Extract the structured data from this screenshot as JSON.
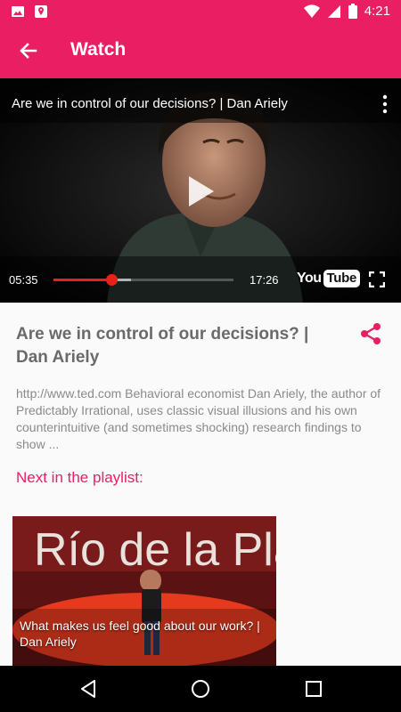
{
  "status_bar": {
    "time": "4:21",
    "icons": [
      "image-icon",
      "location-icon",
      "wifi-icon",
      "signal-icon",
      "battery-icon"
    ]
  },
  "app_bar": {
    "title": "Watch",
    "back_icon": "arrow-back-icon"
  },
  "player": {
    "title": "Are we in control of our decisions? | Dan Ariely",
    "current_time": "05:35",
    "total_time": "17:26",
    "progress": 0.32,
    "buffered": 0.43,
    "logo": {
      "you": "You",
      "tube": "Tube"
    },
    "accent_color": "#e62117"
  },
  "video": {
    "title": "Are we in control of our decisions? | Dan Ariely",
    "description": "http://www.ted.com Behavioral economist Dan Ariely, the author of Predictably Irrational, uses classic visual illusions and his own counterintuitive (and sometimes shocking) research findings to show ..."
  },
  "playlist": {
    "label": "Next in the playlist:",
    "items": [
      {
        "title": "What makes us feel good about our work? | Dan Ariely",
        "backdrop_text": "Río de la Pla"
      }
    ]
  },
  "colors": {
    "primary": "#e91e63",
    "text_heading": "#6a6a6a",
    "text_body": "#8a8a8a"
  }
}
